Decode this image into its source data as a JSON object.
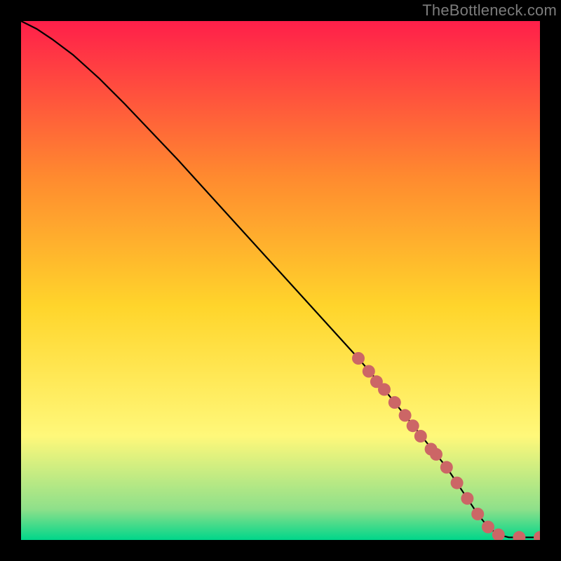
{
  "watermark": "TheBottleneck.com",
  "colors": {
    "bg": "#000000",
    "gradient_top": "#ff1f4a",
    "gradient_upper_mid": "#ff8a2f",
    "gradient_mid": "#ffd52b",
    "gradient_lower_mid": "#fff87a",
    "gradient_near_bottom": "#8fe08a",
    "gradient_bottom": "#00d68a",
    "line": "#000000",
    "marker": "#cc6666"
  },
  "chart_data": {
    "type": "line",
    "title": "",
    "xlabel": "",
    "ylabel": "",
    "xlim": [
      0,
      100
    ],
    "ylim": [
      0,
      100
    ],
    "grid": false,
    "legend": false,
    "series": [
      {
        "name": "curve",
        "x": [
          0,
          3,
          6,
          10,
          15,
          20,
          30,
          40,
          50,
          60,
          65,
          68,
          70,
          72,
          74,
          76,
          78,
          80,
          82,
          84,
          86,
          88,
          90,
          92,
          94,
          96,
          98,
          100
        ],
        "y": [
          100,
          98.5,
          96.5,
          93.5,
          89,
          84,
          73.5,
          62.5,
          51.5,
          40.5,
          35,
          31.5,
          29,
          26.5,
          24,
          21.5,
          19,
          16.5,
          14,
          11,
          8,
          5,
          2.5,
          1,
          0.5,
          0.5,
          0.5,
          0.5
        ]
      }
    ],
    "markers": {
      "name": "highlighted-points",
      "x": [
        65,
        67,
        68.5,
        70,
        72,
        74,
        75.5,
        77,
        79,
        80,
        82,
        84,
        86,
        88,
        90,
        92,
        96,
        100
      ],
      "y": [
        35,
        32.5,
        30.5,
        29,
        26.5,
        24,
        22,
        20,
        17.5,
        16.5,
        14,
        11,
        8,
        5,
        2.5,
        1,
        0.5,
        0.5
      ]
    }
  }
}
